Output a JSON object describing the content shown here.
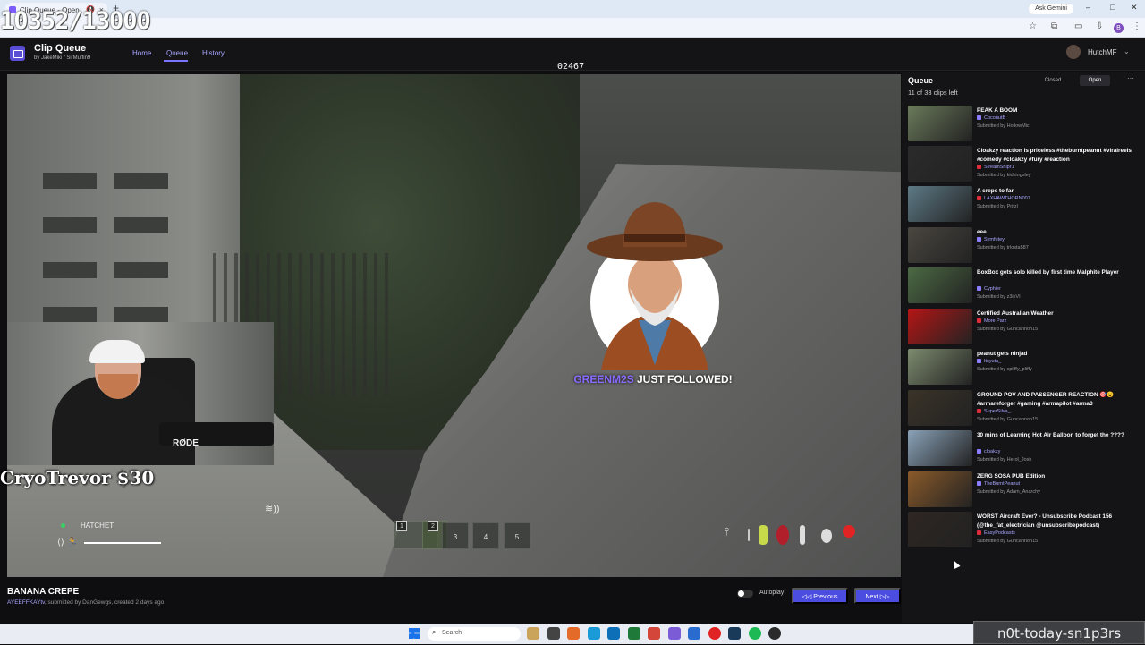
{
  "browser": {
    "tab_title": "Clip Queue - Open",
    "mute_icon": "speaker-muted-icon",
    "close_icon": "×",
    "new_tab": "+",
    "gemini": "Ask Gemini",
    "window_controls": [
      "–",
      "□",
      "✕"
    ],
    "profile_initial": "B"
  },
  "overlay": {
    "counter": "10352/13000"
  },
  "app": {
    "title": "Clip Queue",
    "by_line": "by JakeMiki / SirMuffin9",
    "nav": {
      "home": "Home",
      "queue": "Queue",
      "history": "History"
    },
    "user": "HutchMF",
    "score": "02467"
  },
  "stream": {
    "donation": "CryoTrevor $30",
    "alert_name": "GREENM2S",
    "alert_suffix": " JUST FOLLOWED!",
    "cam_mic_label": "RØDE"
  },
  "hud": {
    "weapon": "HATCHET",
    "slots": [
      "1",
      "2",
      "3",
      "4",
      "5"
    ],
    "audio_icon": "≋))"
  },
  "clip": {
    "title": "BANANA CREPE",
    "channel": "AYEEFFKAYtv",
    "meta_rest": ", submitted by DanGewgs, created 2 days ago"
  },
  "controls": {
    "autoplay": "Autoplay",
    "previous": "◁◁ Previous",
    "next": "Next ▷▷"
  },
  "queue": {
    "title": "Queue",
    "count": "11 of 33 clips left",
    "closed": "Closed",
    "open": "Open",
    "more": "···",
    "items": [
      {
        "title": "PEAK A BOOM",
        "channel": "CoconutB",
        "submitted": "Submitted by HollowMic",
        "red": false,
        "thumb": "#6a7a5a"
      },
      {
        "title": "Cloakzy reaction is priceless #theburntpeanut #viralreels #comedy #cloakzy #fury #reaction",
        "channel": "StreamSnipr1",
        "submitted": "Submitted by kidkingsley",
        "red": true,
        "thumb": "#2b2b2b"
      },
      {
        "title": "A crepe to far",
        "channel": "LAXHAWTHORN007",
        "submitted": "Submitted by Pritzl",
        "red": true,
        "thumb": "#5d7a86"
      },
      {
        "title": "eee",
        "channel": "Symfutey",
        "submitted": "Submitted by trlosta587",
        "red": false,
        "thumb": "#4a4640"
      },
      {
        "title": "BoxBox gets solo killed by first time Malphite Player",
        "channel": "Cyphier",
        "submitted": "Submitted by z3ixVI",
        "red": false,
        "thumb": "#4b6a43"
      },
      {
        "title": "Certified Australian Weather",
        "channel": "More Parz",
        "submitted": "Submitted by Guncannon15",
        "red": true,
        "thumb": "#b51515"
      },
      {
        "title": "peanut gets ninjad",
        "channel": "Itsyuta_",
        "submitted": "Submitted by spliffy_pliffy",
        "red": false,
        "thumb": "#7d8b6e"
      },
      {
        "title": "GROUND POV AND PASSENGER REACTION 🎯😮 #armareforger #gaming #armapilot #arma3",
        "channel": "SuperSilva_",
        "submitted": "Submitted by Guncannon15",
        "red": true,
        "thumb": "#3a3328"
      },
      {
        "title": "30 mins of Learning Hot Air Balloon to forget the ????",
        "channel": "cloakzy",
        "submitted": "Submitted by Herol_Josh",
        "red": false,
        "thumb": "#8aa2b8"
      },
      {
        "title": "ZERG SOSA PUB Edition",
        "channel": "TheBurntPeanut",
        "submitted": "Submitted by Adam_Anarchy",
        "red": false,
        "thumb": "#8a5a2a"
      },
      {
        "title": "WORST Aircraft Ever? - Unsubscribe Podcast 156 (@the_fat_electrician @unsubscribepodcast)",
        "channel": "EasyPodcasts",
        "submitted": "Submitted by Guncannon15",
        "red": true,
        "thumb": "#2e2622"
      }
    ]
  },
  "taskbar": {
    "search": "Search",
    "apps": [
      "#c9a45a",
      "#444",
      "#e46a2a",
      "#1a9bd8",
      "#0d6fb8",
      "#1f7a3a",
      "#d4453a",
      "#7b5cd6",
      "#2a6bd0",
      "#e02424",
      "#1a3a5a",
      "#1db954",
      "#2b2b2b"
    ]
  },
  "watermark": "n0t-today-sn1p3rs"
}
